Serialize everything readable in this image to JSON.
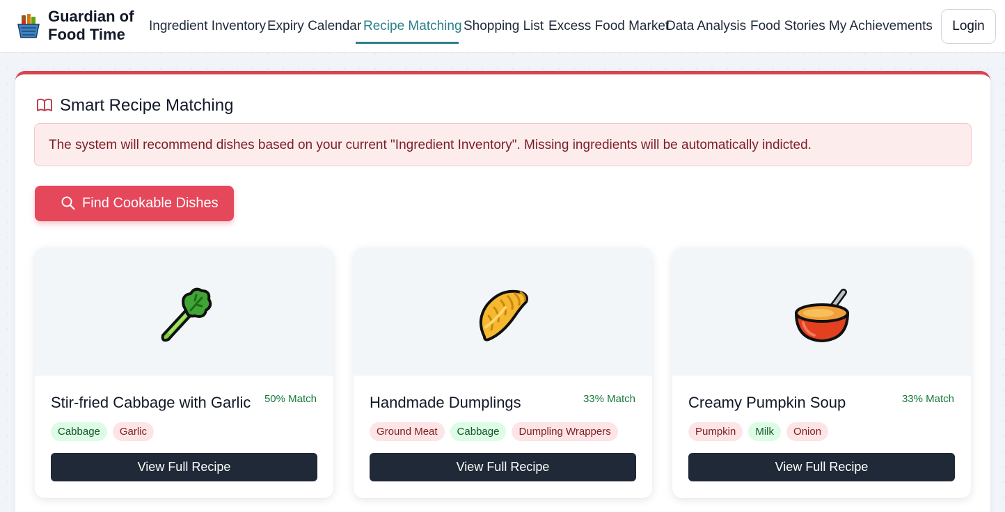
{
  "brand": {
    "line1": "Guardian of",
    "line2": "Food Time"
  },
  "nav": {
    "items": [
      {
        "label": "Ingredient Inventory"
      },
      {
        "label": "Expiry Calendar"
      },
      {
        "label": "Recipe Matching",
        "active": true
      },
      {
        "label": "Shopping List"
      },
      {
        "label": "Excess Food Market"
      },
      {
        "label": "Data Analysis"
      },
      {
        "label": "Food Stories"
      },
      {
        "label": "My Achievements"
      }
    ],
    "login_label": "Login"
  },
  "section": {
    "icon": "book-open-icon",
    "title": "Smart Recipe Matching",
    "notice": "The system will recommend dishes based on your current \"Ingredient Inventory\". Missing ingredients will be automatically indicted.",
    "find_button": {
      "icon": "search-icon",
      "label": "Find Cookable Dishes"
    }
  },
  "recipes": [
    {
      "icon": "celery-icon",
      "title": "Stir-fried Cabbage with Garlic",
      "match": "50% Match",
      "tags": [
        {
          "label": "Cabbage",
          "status": "have"
        },
        {
          "label": "Garlic",
          "status": "missing"
        }
      ],
      "button_label": "View Full Recipe"
    },
    {
      "icon": "dumpling-icon",
      "title": "Handmade Dumplings",
      "match": "33% Match",
      "tags": [
        {
          "label": "Ground Meat",
          "status": "missing"
        },
        {
          "label": "Cabbage",
          "status": "have"
        },
        {
          "label": "Dumpling Wrappers",
          "status": "missing"
        }
      ],
      "button_label": "View Full Recipe"
    },
    {
      "icon": "soup-bowl-icon",
      "title": "Creamy Pumpkin Soup",
      "match": "33% Match",
      "tags": [
        {
          "label": "Pumpkin",
          "status": "missing"
        },
        {
          "label": "Milk",
          "status": "have"
        },
        {
          "label": "Onion",
          "status": "missing"
        }
      ],
      "button_label": "View Full Recipe"
    }
  ],
  "colors": {
    "accent_red": "#e5475b",
    "active_teal": "#2a7f8c",
    "have_tag": "#dcfce4",
    "missing_tag": "#fde4e6",
    "dark_button": "#1f2937"
  }
}
